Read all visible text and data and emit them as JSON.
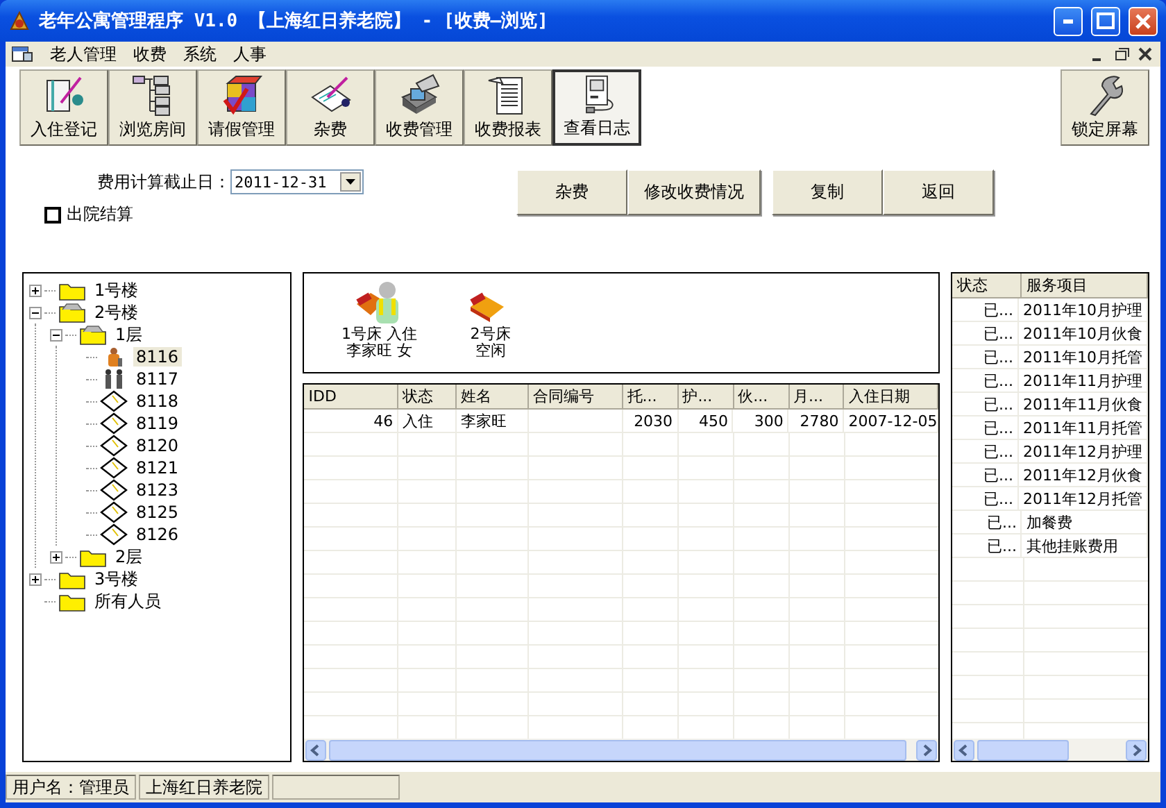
{
  "window": {
    "title": "老年公寓管理程序 V1.0 【上海红日养老院】 - [收费—浏览]"
  },
  "menu": [
    "老人管理",
    "收费",
    "系统",
    "人事"
  ],
  "toolbar": [
    {
      "label": "入住登记",
      "kind": "checkin",
      "selected": false
    },
    {
      "label": "浏览房间",
      "kind": "rooms",
      "selected": false
    },
    {
      "label": "请假管理",
      "kind": "leave",
      "selected": false
    },
    {
      "label": "杂费",
      "kind": "misc",
      "selected": false
    },
    {
      "label": "收费管理",
      "kind": "fees",
      "selected": false
    },
    {
      "label": "收费报表",
      "kind": "report",
      "selected": false
    },
    {
      "label": "查看日志",
      "kind": "log",
      "selected": true
    }
  ],
  "lock_button": {
    "label": "锁定屏幕"
  },
  "filter": {
    "date_label": "费用计算截止日：",
    "date_value": "2011-12-31",
    "checkbox": {
      "label": "出院结算",
      "checked": false
    }
  },
  "actions": [
    [
      "杂费",
      "修改收费情况"
    ],
    [
      "复制",
      "返回"
    ]
  ],
  "tree": [
    {
      "label": "1号楼",
      "kind": "folder",
      "expanded": false,
      "selected": false
    },
    {
      "label": "2号楼",
      "kind": "folder",
      "expanded": true,
      "selected": false,
      "children": [
        {
          "label": "1层",
          "kind": "folder",
          "expanded": true,
          "selected": false,
          "children": [
            {
              "label": "8116",
              "kind": "occupied",
              "selected": true
            },
            {
              "label": "8117",
              "kind": "double",
              "selected": false
            },
            {
              "label": "8118",
              "kind": "empty",
              "selected": false
            },
            {
              "label": "8119",
              "kind": "empty",
              "selected": false
            },
            {
              "label": "8120",
              "kind": "empty",
              "selected": false
            },
            {
              "label": "8121",
              "kind": "empty",
              "selected": false
            },
            {
              "label": "8123",
              "kind": "empty",
              "selected": false
            },
            {
              "label": "8125",
              "kind": "empty",
              "selected": false
            },
            {
              "label": "8126",
              "kind": "empty",
              "selected": false
            }
          ]
        },
        {
          "label": "2层",
          "kind": "folder",
          "expanded": false,
          "selected": false
        }
      ]
    },
    {
      "label": "3号楼",
      "kind": "folder",
      "expanded": false,
      "selected": false
    },
    {
      "label": "所有人员",
      "kind": "folder",
      "selected": false
    }
  ],
  "beds": [
    {
      "kind": "occupied",
      "lines": [
        "1号床 入住",
        "李家旺 女"
      ]
    },
    {
      "kind": "empty",
      "lines": [
        "2号床",
        "空闲"
      ]
    }
  ],
  "table": {
    "columns": [
      "IDD",
      "状态",
      "姓名",
      "合同编号",
      "托...",
      "护...",
      "伙...",
      "月...",
      "入住日期"
    ],
    "rows": [
      [
        "46",
        "入住",
        "李家旺",
        "",
        "2030",
        "450",
        "300",
        "2780",
        "2007-12-05"
      ]
    ]
  },
  "services": {
    "columns": [
      "状态",
      "服务项目"
    ],
    "rows": [
      [
        "已...",
        "2011年10月护理"
      ],
      [
        "已...",
        "2011年10月伙食"
      ],
      [
        "已...",
        "2011年10月托管"
      ],
      [
        "已...",
        "2011年11月护理"
      ],
      [
        "已...",
        "2011年11月伙食"
      ],
      [
        "已...",
        "2011年11月托管"
      ],
      [
        "已...",
        "2011年12月护理"
      ],
      [
        "已...",
        "2011年12月伙食"
      ],
      [
        "已...",
        "2011年12月托管"
      ],
      [
        "已...",
        "加餐费"
      ],
      [
        "已...",
        "其他挂账费用"
      ]
    ]
  },
  "status_bar": [
    "用户名：管理员",
    "上海红日养老院"
  ]
}
